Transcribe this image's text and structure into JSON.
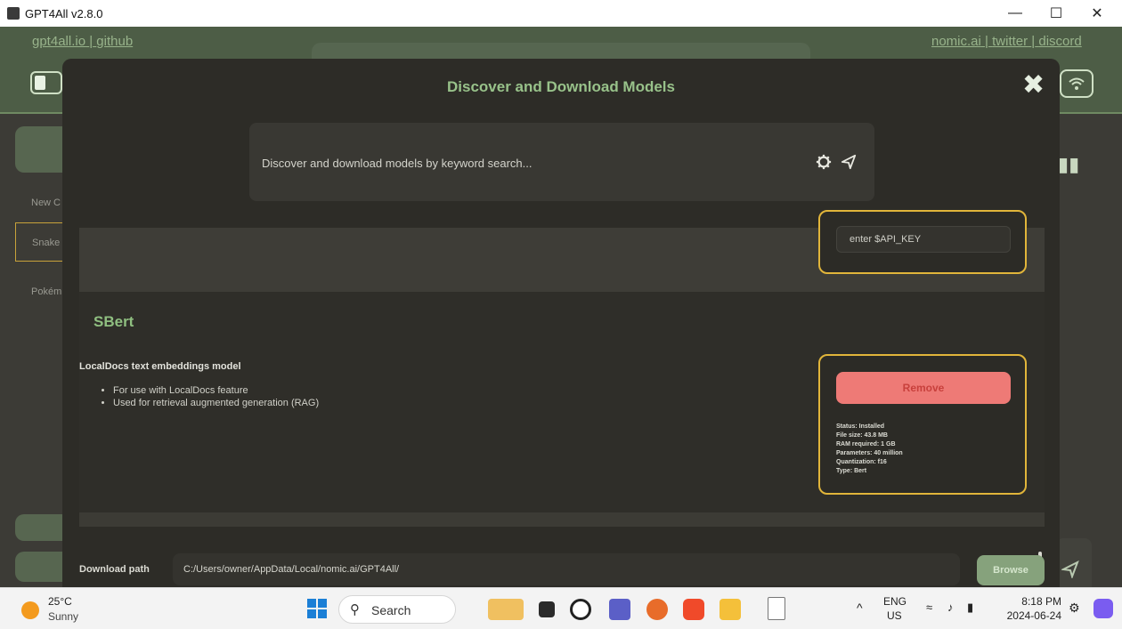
{
  "window": {
    "title": "GPT4All v2.8.0",
    "minimize": "—",
    "maximize": "☐",
    "close": "✕"
  },
  "header": {
    "left_links": [
      "gpt4all.io",
      "github"
    ],
    "right_links": [
      "nomic.ai",
      "twitter",
      "discord"
    ],
    "separator": "|"
  },
  "sidebar": {
    "items": [
      "New C",
      "Snake",
      "Pokém"
    ]
  },
  "dialog": {
    "title": "Discover and Download Models",
    "close_glyph": "✖",
    "search": {
      "placeholder": "Discover and download models by keyword search..."
    },
    "api_key": {
      "placeholder": "enter $API_KEY"
    },
    "model": {
      "name": "SBert",
      "description": "LocalDocs text embeddings model",
      "bullets": [
        "For use with LocalDocs feature",
        "Used for retrieval augmented generation (RAG)"
      ],
      "remove_label": "Remove",
      "info": [
        "Status: Installed",
        "File size: 43.8 MB",
        "RAM required: 1 GB",
        "Parameters: 40 million",
        "Quantization: f16",
        "Type: Bert"
      ]
    },
    "download": {
      "label": "Download path",
      "path": "C:/Users/owner/AppData/Local/nomic.ai/GPT4All/",
      "browse_label": "Browse"
    }
  },
  "taskbar": {
    "temperature": "25°C",
    "weather": "Sunny",
    "search_label": "Search",
    "language": "ENG",
    "region": "US",
    "time": "8:18 PM",
    "date": "2024-06-24"
  },
  "colors": {
    "accent_green": "#98c28a",
    "yellow_border": "#e1b53a",
    "remove_red": "#ee7a76",
    "browse_green": "#86a27c"
  }
}
